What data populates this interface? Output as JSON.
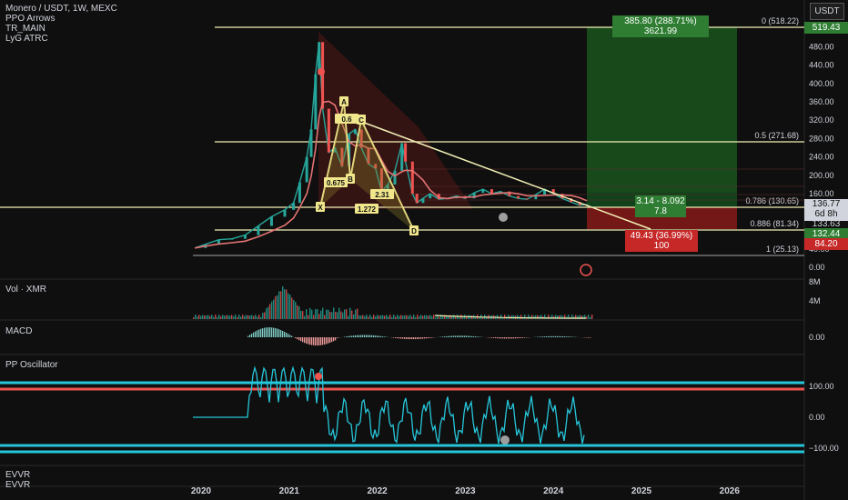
{
  "header": {
    "symbol": "Monero / USDT, 1W, MEXC",
    "indicators": [
      "PPO Arrows",
      "TR_MAIN",
      "LyG ATRC"
    ],
    "currency_button": "USDT"
  },
  "price_axis": {
    "labels": [
      "480.00",
      "440.00",
      "400.00",
      "360.00",
      "320.00",
      "280.00",
      "240.00",
      "200.00",
      "160.00",
      "40.00",
      "0.00"
    ]
  },
  "price_tags": {
    "high": "519.43",
    "current": "136.77",
    "countdown": "6d 8h",
    "under_current": "133.63",
    "stop": "132.44",
    "low": "84.20"
  },
  "fib_levels": [
    {
      "ratio": "0",
      "label": "0 (518.22)",
      "price": 518.22
    },
    {
      "ratio": "0.5",
      "label": "0.5 (271.68)",
      "price": 271.68
    },
    {
      "ratio": "0.786",
      "label": "0.786 (130.65)",
      "price": 130.65
    },
    {
      "ratio": "0.886",
      "label": "0.886 (81.34)",
      "price": 81.34
    },
    {
      "ratio": "1",
      "label": "1 (25.13)",
      "price": 25.13
    }
  ],
  "position": {
    "profit_label": "385.80 (288.71%) 3621.99",
    "ratio_label": "3.14 - 8.092",
    "rr_label": "7.8",
    "loss_label": "49.43 (36.99%) 100"
  },
  "harmonic": {
    "points": [
      "X",
      "A",
      "B",
      "C",
      "D"
    ],
    "ratios": [
      "0.6",
      "0.675",
      "2.31",
      "1.272"
    ]
  },
  "panes": {
    "volume": {
      "title": "Vol · XMR",
      "axis": [
        "8M",
        "4M"
      ]
    },
    "macd": {
      "title": "MACD",
      "axis": [
        "0.00"
      ]
    },
    "pp": {
      "title": "PP Oscillator",
      "axis": [
        "100.00",
        "0.00",
        "−100.00"
      ]
    },
    "evvr": {
      "title": "EVVR",
      "title2": "EVVR"
    }
  },
  "time_axis": [
    "2020",
    "2021",
    "2022",
    "2023",
    "2024",
    "2025",
    "2026"
  ],
  "colors": {
    "background": "#0f0f0f",
    "up": "#26a69a",
    "down": "#ef5350",
    "fib": "#f2f0b5",
    "profit_zone": "#1b5e20",
    "loss_zone": "#7f1d1d",
    "pattern": "#f0e68c",
    "oscillator": "#26c6da"
  },
  "chart_data": {
    "type": "line",
    "title": "Monero / USDT, 1W, MEXC",
    "x_unit": "year",
    "x": [
      2019.93,
      2020.05,
      2020.2,
      2020.35,
      2020.5,
      2020.65,
      2020.8,
      2020.95,
      2021.05,
      2021.12,
      2021.2,
      2021.25,
      2021.3,
      2021.34,
      2021.38,
      2021.45,
      2021.52,
      2021.6,
      2021.68,
      2021.75,
      2021.82,
      2021.9,
      2021.98,
      2022.05,
      2022.12,
      2022.2,
      2022.28,
      2022.32,
      2022.4,
      2022.45,
      2022.52,
      2022.6,
      2022.7,
      2022.8,
      2022.9,
      2023.0,
      2023.1,
      2023.2,
      2023.3,
      2023.4,
      2023.5,
      2023.6,
      2023.7,
      2023.8,
      2023.9,
      2024.0,
      2024.1,
      2024.2,
      2024.3,
      2024.38
    ],
    "series": [
      {
        "values": [
          42,
          50,
          60,
          62,
          70,
          90,
          110,
          125,
          140,
          185,
          240,
          300,
          420,
          490,
          345,
          250,
          260,
          220,
          290,
          300,
          260,
          225,
          215,
          165,
          180,
          210,
          270,
          230,
          160,
          140,
          150,
          160,
          148,
          150,
          155,
          150,
          162,
          170,
          160,
          165,
          155,
          150,
          148,
          158,
          170,
          160,
          150,
          142,
          135,
          136.77
        ]
      }
    ],
    "ylim": [
      0,
      540
    ]
  }
}
